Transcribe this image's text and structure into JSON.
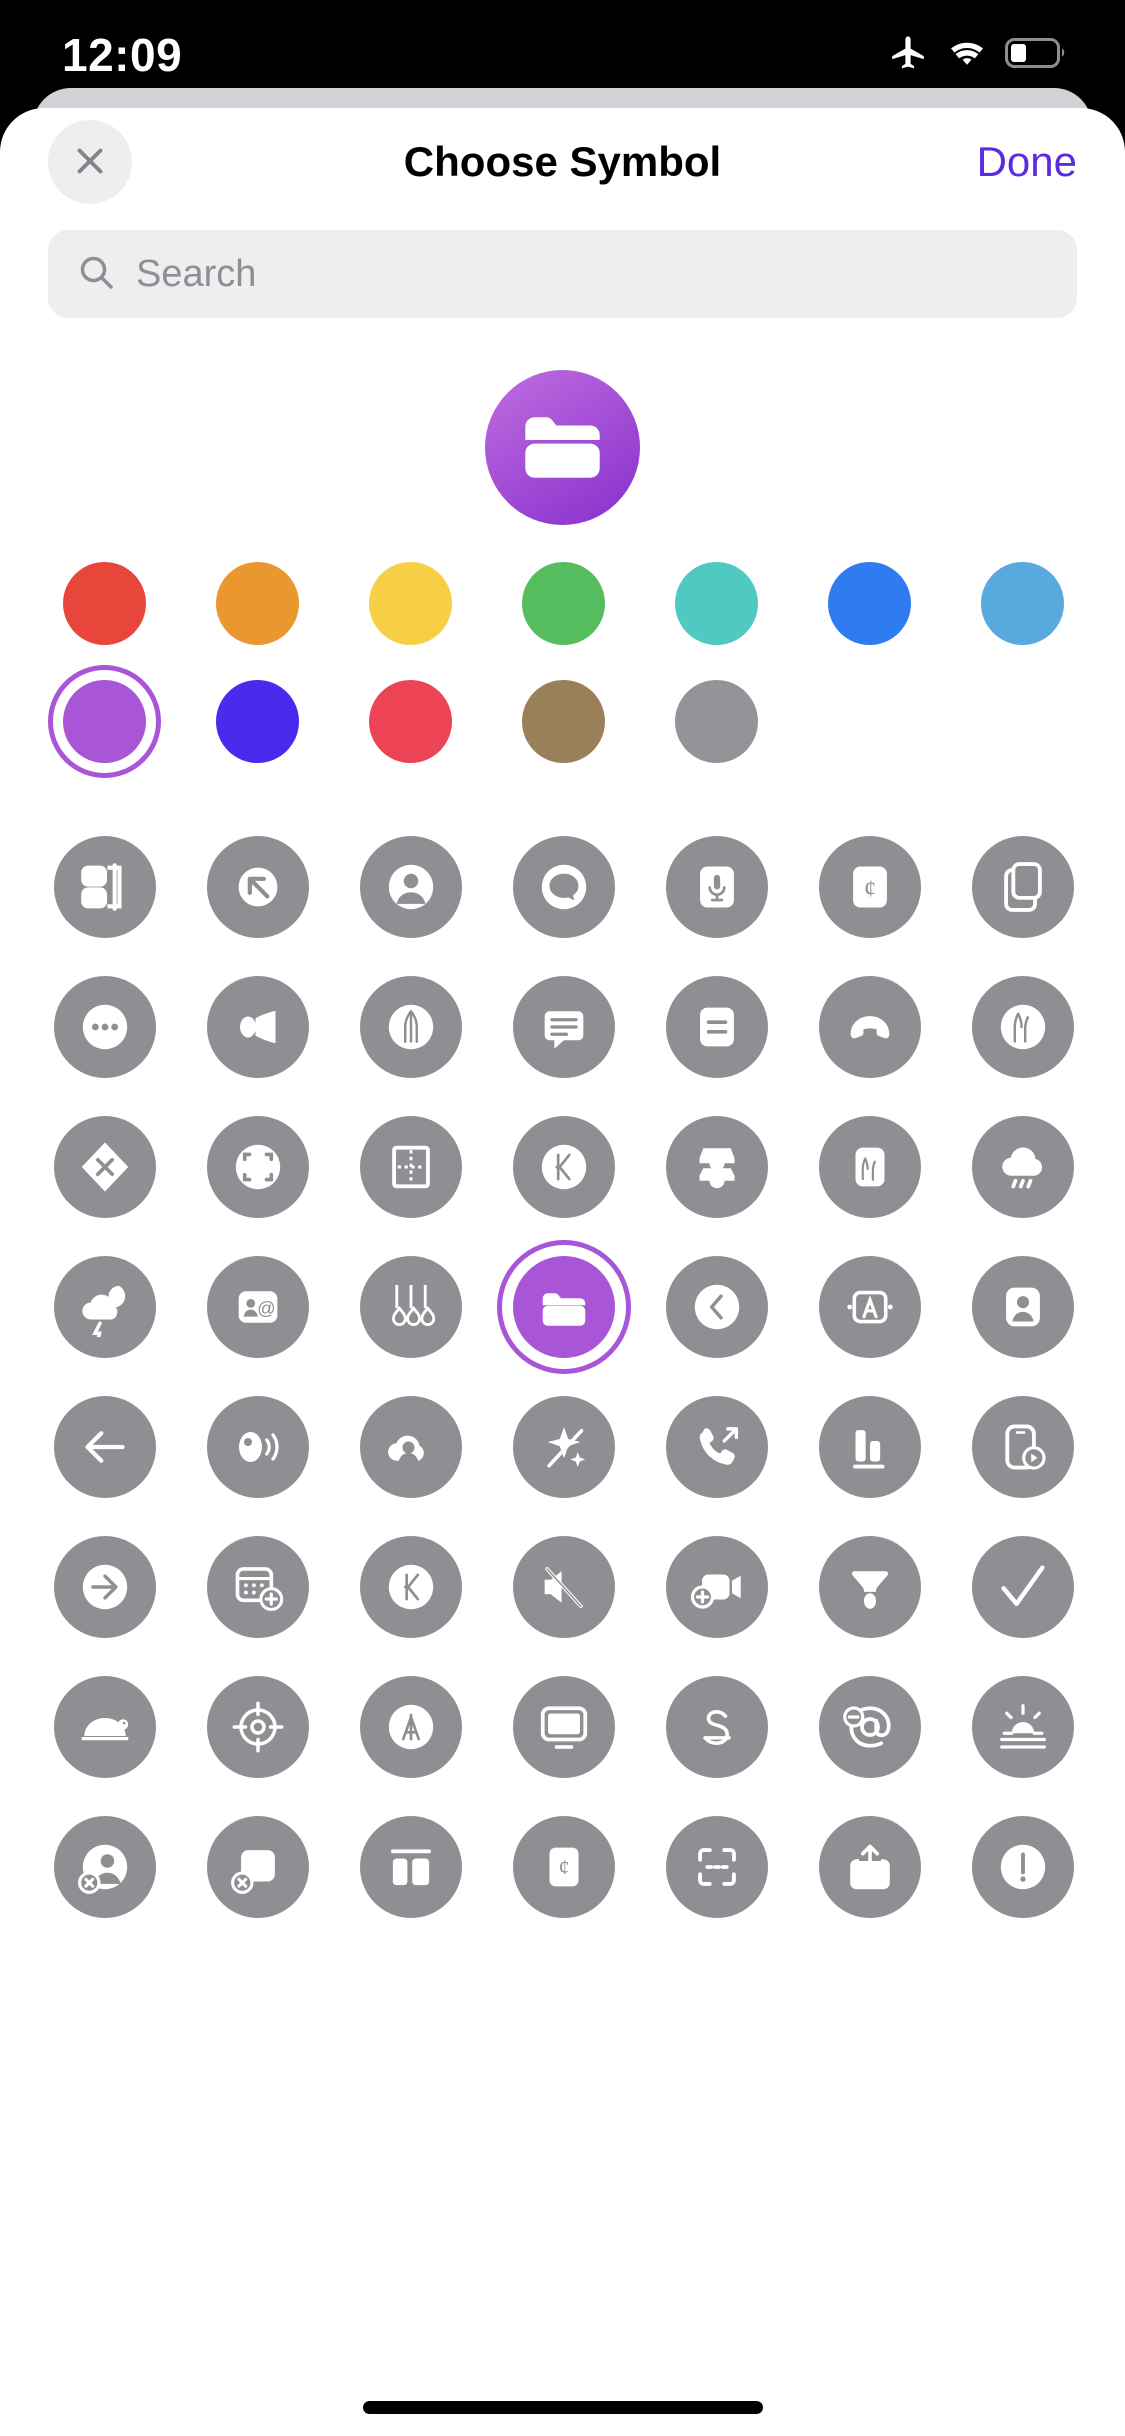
{
  "status_bar": {
    "time": "12:09",
    "icons": [
      "airplane-mode-icon",
      "wifi-icon",
      "battery-icon"
    ],
    "battery_level_pct": 30
  },
  "header": {
    "title": "Choose Symbol",
    "close_label": "×",
    "close_icon": "close-icon",
    "done_label": "Done",
    "done_color": "#5b2be0"
  },
  "search": {
    "placeholder": "Search",
    "value": "",
    "icon": "search-icon"
  },
  "preview": {
    "symbol": "folder",
    "gradient_from": "#c06de0",
    "gradient_to": "#8e38cf",
    "glyph_color": "#ffffff"
  },
  "colors": {
    "selected_index": 7,
    "selected_hex": "#a855d8",
    "rows": [
      [
        {
          "name": "red",
          "hex": "#e8463a"
        },
        {
          "name": "orange",
          "hex": "#ea972f"
        },
        {
          "name": "yellow",
          "hex": "#f6cf44"
        },
        {
          "name": "green",
          "hex": "#56bd5f"
        },
        {
          "name": "teal",
          "hex": "#4fc9c2"
        },
        {
          "name": "blue",
          "hex": "#2f7bf0"
        },
        {
          "name": "light-blue",
          "hex": "#57a9de"
        }
      ],
      [
        {
          "name": "purple",
          "hex": "#a855d8"
        },
        {
          "name": "indigo",
          "hex": "#4a2bee"
        },
        {
          "name": "pink",
          "hex": "#ec4455"
        },
        {
          "name": "brown",
          "hex": "#9a8059"
        },
        {
          "name": "gray",
          "hex": "#939398"
        }
      ]
    ]
  },
  "symbols": {
    "selected_row": 3,
    "selected_col": 3,
    "circle_color": "#8e8e93",
    "selected_color": "#a855d8",
    "rows": [
      [
        "sidebar-squares-icon",
        "arrow-up-left-icon",
        "person-circle-icon",
        "bubble-icon",
        "mic-rectangle-icon",
        "cent-sign-rectangle-icon",
        "doc-on-doc-icon"
      ],
      [
        "ellipsis-circle-icon",
        "megaphone-icon",
        "music-note-icon",
        "message-lines-icon",
        "text-lines-rectangle-icon",
        "phone-down-icon",
        "music-notes-icon"
      ],
      [
        "xmark-diamond-icon",
        "viewfinder-icon",
        "perforated-rectangle-icon",
        "k-circle-icon",
        "tray-two-icon",
        "music-rectangle-icon",
        "cloud-rain-icon"
      ],
      [
        "cloud-moon-bolt-icon",
        "person-at-rectangle-icon",
        "guitars-icon",
        "folder-icon",
        "chevron-left-icon",
        "a-rectangle-icon",
        "person-crop-icon"
      ],
      [
        "arrow-left-icon",
        "speaker-wave-icon",
        "cloud-person-icon",
        "sparkles-slash-icon",
        "phone-arrow-up-right-icon",
        "chart-bar-icon",
        "iphone-play-icon"
      ],
      [
        "arrow-right-icon",
        "calendar-badge-plus-icon",
        "k-circle-icon",
        "speaker-slash-icon",
        "video-badge-plus-icon",
        "funnel-icon",
        "checkmark-icon"
      ],
      [
        "tortoise-icon",
        "scope-icon",
        "a-circle-icon",
        "display-icon",
        "s-slash-icon",
        "at-badge-minus-icon",
        "sunrise-icon"
      ],
      [
        "person-badge-xmark-icon",
        "rectangle-badge-xmark-icon",
        "sidebar-split-icon",
        "doc-badge-icon",
        "viewfinder-badge-icon",
        "arrow-up-square-icon",
        "exclamationmark-circle-icon"
      ]
    ]
  },
  "home_indicator": "home-indicator"
}
